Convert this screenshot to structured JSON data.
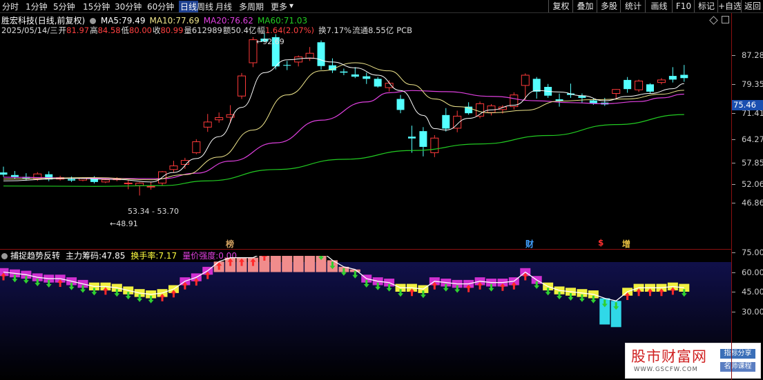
{
  "toolbar": {
    "periods": [
      {
        "label": "分时",
        "active": false
      },
      {
        "label": "1分钟",
        "active": false
      },
      {
        "label": "5分钟",
        "active": false
      },
      {
        "label": "15分钟",
        "active": false
      },
      {
        "label": "30分钟",
        "active": false
      },
      {
        "label": "60分钟",
        "active": false
      },
      {
        "label": "日线",
        "active": true
      },
      {
        "label": "周线",
        "active": false
      },
      {
        "label": "月线",
        "active": false
      },
      {
        "label": "多周期",
        "active": false
      },
      {
        "label": "更多",
        "active": false
      }
    ],
    "more_arrow": "▾",
    "right_buttons": [
      "复权",
      "叠加",
      "多股",
      "统计",
      "画线",
      "F10",
      "标记",
      "+自选",
      "返回"
    ]
  },
  "header": {
    "stock_name": "胜宏科技",
    "mode": "(日线,前复权)",
    "ma": [
      {
        "label": "MA5:",
        "value": "79.49",
        "color": "#ffffff"
      },
      {
        "label": "MA10:",
        "value": "77.69",
        "color": "#f0e68c"
      },
      {
        "label": "MA20:",
        "value": "76.62",
        "color": "#e040e0"
      },
      {
        "label": "MA60:",
        "value": "71.03",
        "color": "#22cc22"
      }
    ]
  },
  "info": {
    "date": "2025/05/14/三",
    "open_label": "开",
    "open": "81.97",
    "high_label": "高",
    "high": "84.58",
    "low_label": "低",
    "low": "80.00",
    "close_label": "收",
    "close": "80.99",
    "vol_label": "量",
    "vol": "612989",
    "amt_label": "额",
    "amt": "50.4亿",
    "chg_label": "幅",
    "chg": "1.64(2.07%)",
    "turnover_label": "换",
    "turnover": "7.17%",
    "float_label": "流通",
    "float_cap": "8.55亿",
    "sector": "PCB"
  },
  "price_axis": [
    "87.28",
    "79.35",
    "71.41",
    "64.27",
    "57.85",
    "52.06",
    "46.86"
  ],
  "current_price": "75.46",
  "annotations": {
    "high": "92.69",
    "low": "48.91",
    "range": "53.34 - 53.70"
  },
  "markers": [
    {
      "text": "榜",
      "color": "#d0a060"
    },
    {
      "text": "财",
      "color": "#40a0ff"
    },
    {
      "text": "$",
      "color": "#ff3030"
    },
    {
      "text": "增",
      "color": "#e8c040"
    }
  ],
  "indicator": {
    "name": "捕捉趋势反转",
    "items": [
      {
        "label": "主力筹码:",
        "value": "47.85",
        "color": "#ffffff"
      },
      {
        "label": "换手率:",
        "value": "7.17",
        "color": "#ffff40"
      },
      {
        "label": "量价强度:",
        "value": "0.00",
        "color": "#e040e0"
      }
    ],
    "axis": [
      "75.00",
      "60.00",
      "45.00",
      "30.00"
    ]
  },
  "watermark": {
    "logo": "股市财富网",
    "url": "WWW.GSCFW.COM",
    "tag1": "指标分享",
    "tag2": "名师课程"
  },
  "colors": {
    "up": "#ff3a3a",
    "down": "#54ffff",
    "ma5": "#ffffff",
    "ma10": "#f0e68c",
    "ma20": "#e040e0",
    "ma60": "#22cc22"
  },
  "chart_data": {
    "type": "candlestick",
    "ylim": [
      44.5,
      97
    ],
    "candles": [
      {
        "o": 55.2,
        "h": 56.8,
        "l": 54.0,
        "c": 54.6
      },
      {
        "o": 54.5,
        "h": 55.6,
        "l": 53.4,
        "c": 54.0
      },
      {
        "o": 54.0,
        "h": 55.0,
        "l": 53.0,
        "c": 53.6
      },
      {
        "o": 53.4,
        "h": 55.3,
        "l": 52.9,
        "c": 54.8
      },
      {
        "o": 54.7,
        "h": 55.5,
        "l": 52.8,
        "c": 53.3
      },
      {
        "o": 53.4,
        "h": 54.3,
        "l": 53.0,
        "c": 53.8
      },
      {
        "o": 53.4,
        "h": 54.1,
        "l": 52.6,
        "c": 53.0
      },
      {
        "o": 53.1,
        "h": 53.9,
        "l": 52.8,
        "c": 53.6
      },
      {
        "o": 53.8,
        "h": 54.2,
        "l": 52.2,
        "c": 52.6
      },
      {
        "o": 52.6,
        "h": 53.5,
        "l": 52.3,
        "c": 53.2
      },
      {
        "o": 53.3,
        "h": 53.9,
        "l": 52.8,
        "c": 53.4
      },
      {
        "o": 52.3,
        "h": 53.2,
        "l": 50.6,
        "c": 52.3
      },
      {
        "o": 51.6,
        "h": 52.5,
        "l": 48.9,
        "c": 52.3
      },
      {
        "o": 51.4,
        "h": 52.6,
        "l": 50.5,
        "c": 51.4
      },
      {
        "o": 52.3,
        "h": 55.6,
        "l": 51.7,
        "c": 55.4
      },
      {
        "o": 56.0,
        "h": 58.4,
        "l": 55.2,
        "c": 57.0
      },
      {
        "o": 57.4,
        "h": 59.2,
        "l": 56.2,
        "c": 58.5
      },
      {
        "o": 60.6,
        "h": 64.3,
        "l": 60.2,
        "c": 63.6
      },
      {
        "o": 67.6,
        "h": 71.2,
        "l": 66.3,
        "c": 69.0
      },
      {
        "o": 69.6,
        "h": 71.6,
        "l": 68.8,
        "c": 70.2
      },
      {
        "o": 70.3,
        "h": 73.6,
        "l": 68.7,
        "c": 71.0
      },
      {
        "o": 76.1,
        "h": 82.4,
        "l": 75.3,
        "c": 81.6
      },
      {
        "o": 85.2,
        "h": 92.2,
        "l": 84.0,
        "c": 91.5
      },
      {
        "o": 91.8,
        "h": 93.2,
        "l": 90.8,
        "c": 91.0
      },
      {
        "o": 92.2,
        "h": 93.0,
        "l": 83.4,
        "c": 84.2
      },
      {
        "o": 84.6,
        "h": 85.7,
        "l": 83.2,
        "c": 84.4
      },
      {
        "o": 85.4,
        "h": 87.2,
        "l": 84.2,
        "c": 86.8
      },
      {
        "o": 86.4,
        "h": 89.5,
        "l": 85.7,
        "c": 87.8
      },
      {
        "o": 90.8,
        "h": 91.3,
        "l": 83.3,
        "c": 84.3
      },
      {
        "o": 84.5,
        "h": 86.4,
        "l": 82.4,
        "c": 83.1
      },
      {
        "o": 82.8,
        "h": 83.6,
        "l": 81.8,
        "c": 82.5
      },
      {
        "o": 82.0,
        "h": 84.0,
        "l": 81.0,
        "c": 81.4
      },
      {
        "o": 81.5,
        "h": 82.5,
        "l": 79.4,
        "c": 80.8
      },
      {
        "o": 80.8,
        "h": 81.3,
        "l": 78.4,
        "c": 78.7
      },
      {
        "o": 78.4,
        "h": 80.4,
        "l": 77.3,
        "c": 79.6
      },
      {
        "o": 75.3,
        "h": 76.4,
        "l": 71.4,
        "c": 72.3
      },
      {
        "o": 65.0,
        "h": 68.0,
        "l": 60.6,
        "c": 64.5
      },
      {
        "o": 66.5,
        "h": 67.6,
        "l": 59.6,
        "c": 62.2
      },
      {
        "o": 60.6,
        "h": 65.4,
        "l": 59.4,
        "c": 64.6
      },
      {
        "o": 70.9,
        "h": 72.8,
        "l": 66.4,
        "c": 67.2
      },
      {
        "o": 67.3,
        "h": 72.1,
        "l": 66.2,
        "c": 70.6
      },
      {
        "o": 73.2,
        "h": 74.4,
        "l": 71.0,
        "c": 71.4
      },
      {
        "o": 70.6,
        "h": 74.6,
        "l": 70.0,
        "c": 74.0
      },
      {
        "o": 71.6,
        "h": 73.9,
        "l": 70.8,
        "c": 73.4
      },
      {
        "o": 72.4,
        "h": 73.6,
        "l": 71.3,
        "c": 73.1
      },
      {
        "o": 73.2,
        "h": 77.1,
        "l": 72.4,
        "c": 76.4
      },
      {
        "o": 79.0,
        "h": 82.3,
        "l": 75.1,
        "c": 81.8
      },
      {
        "o": 80.8,
        "h": 81.3,
        "l": 75.4,
        "c": 77.3
      },
      {
        "o": 78.6,
        "h": 79.4,
        "l": 75.6,
        "c": 76.2
      },
      {
        "o": 75.2,
        "h": 76.8,
        "l": 73.2,
        "c": 74.8
      },
      {
        "o": 76.8,
        "h": 79.5,
        "l": 75.6,
        "c": 76.4
      },
      {
        "o": 76.1,
        "h": 76.8,
        "l": 74.2,
        "c": 75.6
      },
      {
        "o": 74.9,
        "h": 75.5,
        "l": 73.7,
        "c": 74.1
      },
      {
        "o": 74.3,
        "h": 75.6,
        "l": 73.4,
        "c": 73.8
      },
      {
        "o": 76.8,
        "h": 78.0,
        "l": 75.2,
        "c": 77.9
      },
      {
        "o": 80.5,
        "h": 81.3,
        "l": 77.0,
        "c": 78.0
      },
      {
        "o": 77.8,
        "h": 80.6,
        "l": 77.2,
        "c": 80.2
      },
      {
        "o": 79.3,
        "h": 79.6,
        "l": 76.8,
        "c": 77.3
      },
      {
        "o": 79.8,
        "h": 81.0,
        "l": 79.3,
        "c": 80.5
      },
      {
        "o": 81.6,
        "h": 84.0,
        "l": 79.8,
        "c": 80.6
      },
      {
        "o": 81.9,
        "h": 84.6,
        "l": 80.0,
        "c": 81.0
      }
    ],
    "ma5": [
      [
        0,
        52.9
      ],
      [
        6,
        53.6
      ],
      [
        10,
        53.3
      ],
      [
        13,
        52.6
      ],
      [
        15,
        55.2
      ],
      [
        17,
        59.0
      ],
      [
        19,
        65.0
      ],
      [
        21,
        73.0
      ],
      [
        23,
        82.5
      ],
      [
        25,
        86.0
      ],
      [
        27,
        86.5
      ],
      [
        29,
        85.4
      ],
      [
        31,
        83.8
      ],
      [
        33,
        81.8
      ],
      [
        35,
        77.6
      ],
      [
        37,
        70.8
      ],
      [
        38,
        67.2
      ],
      [
        39,
        66.8
      ],
      [
        41,
        70.0
      ],
      [
        43,
        72.3
      ],
      [
        45,
        73.6
      ],
      [
        47,
        77.6
      ],
      [
        49,
        77.2
      ],
      [
        51,
        76.2
      ],
      [
        53,
        74.8
      ],
      [
        55,
        76.0
      ],
      [
        57,
        76.8
      ],
      [
        59,
        78.1
      ],
      [
        60,
        79.49
      ]
    ],
    "ma10": [
      [
        0,
        53.4
      ],
      [
        8,
        53.8
      ],
      [
        13,
        53.2
      ],
      [
        16,
        54.6
      ],
      [
        19,
        59.4
      ],
      [
        22,
        66.8
      ],
      [
        25,
        76.4
      ],
      [
        28,
        83.0
      ],
      [
        31,
        85.2
      ],
      [
        34,
        83.0
      ],
      [
        36,
        79.2
      ],
      [
        38,
        75.3
      ],
      [
        40,
        73.2
      ],
      [
        43,
        71.5
      ],
      [
        46,
        72.2
      ],
      [
        49,
        74.7
      ],
      [
        52,
        75.1
      ],
      [
        55,
        75.3
      ],
      [
        58,
        76.6
      ],
      [
        60,
        77.69
      ]
    ],
    "ma20": [
      [
        0,
        53.9
      ],
      [
        8,
        53.6
      ],
      [
        14,
        53.5
      ],
      [
        17,
        55.0
      ],
      [
        20,
        58.3
      ],
      [
        24,
        63.3
      ],
      [
        28,
        69.5
      ],
      [
        32,
        74.5
      ],
      [
        34,
        77.0
      ],
      [
        36,
        77.6
      ],
      [
        39,
        77.3
      ],
      [
        43,
        76.0
      ],
      [
        47,
        74.8
      ],
      [
        50,
        74.3
      ],
      [
        53,
        74.0
      ],
      [
        56,
        74.6
      ],
      [
        58,
        75.6
      ],
      [
        60,
        76.62
      ]
    ],
    "ma60": [
      [
        0,
        51.5
      ],
      [
        8,
        51.4
      ],
      [
        14,
        51.6
      ],
      [
        18,
        52.9
      ],
      [
        24,
        56.0
      ],
      [
        30,
        58.8
      ],
      [
        36,
        61.2
      ],
      [
        42,
        63.0
      ],
      [
        48,
        65.3
      ],
      [
        54,
        68.3
      ],
      [
        60,
        71.03
      ]
    ],
    "indicator": {
      "ylim": [
        22,
        90
      ],
      "line": [
        60,
        59,
        58,
        56,
        55,
        55,
        53,
        51,
        49,
        49,
        48,
        46,
        44,
        43,
        44,
        47,
        53,
        56,
        61,
        68,
        71,
        71,
        71,
        75,
        82,
        84,
        85,
        84,
        76,
        69,
        64,
        62,
        55,
        53,
        52,
        48,
        48,
        47,
        53,
        52,
        51,
        51,
        53,
        52,
        52,
        53,
        60,
        54,
        49,
        46,
        45,
        44,
        43,
        40,
        38,
        45,
        48,
        48,
        48,
        49,
        48
      ]
    }
  }
}
